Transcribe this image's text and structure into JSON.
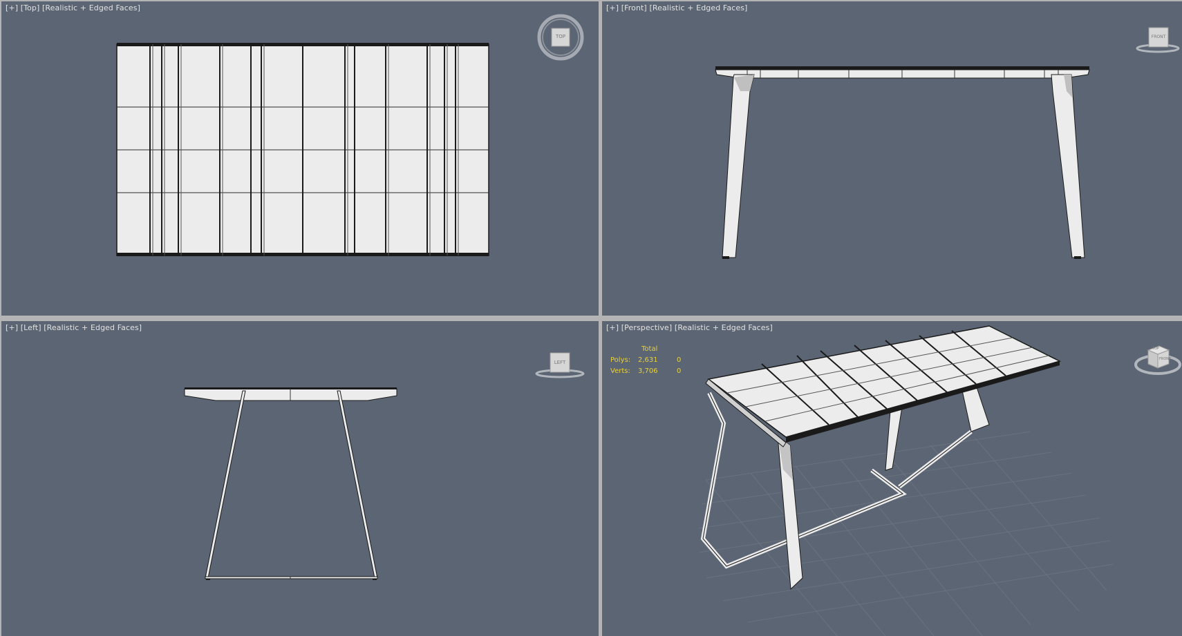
{
  "colors": {
    "viewport_bg": "#5c6573",
    "border": "#b4b4b4",
    "label_text": "#e2e2e2",
    "stats_text": "#e8d23a",
    "model_face": "#ececec",
    "model_edge": "#1a1a1a"
  },
  "viewports": {
    "top": {
      "plus": "[+]",
      "view": "[Top]",
      "mode": "[Realistic + Edged Faces]",
      "cube_label": "TOP",
      "cube_icon": "viewcube-icon"
    },
    "front": {
      "plus": "[+]",
      "view": "[Front]",
      "mode": "[Realistic + Edged Faces]",
      "cube_label": "FRONT",
      "cube_icon": "viewcube-icon"
    },
    "left": {
      "plus": "[+]",
      "view": "[Left]",
      "mode": "[Realistic + Edged Faces]",
      "cube_label": "LEFT",
      "cube_icon": "viewcube-icon"
    },
    "perspective": {
      "plus": "[+]",
      "view": "[Perspective]",
      "mode": "[Realistic + Edged Faces]",
      "cube_label": "TOP",
      "cube_label_2": "FRONT",
      "cube_icon": "viewcube-icon"
    }
  },
  "stats": {
    "header": "Total",
    "rows": [
      {
        "label": "Polys:",
        "total": "2,631",
        "selected": "0"
      },
      {
        "label": "Verts:",
        "total": "3,706",
        "selected": "0"
      }
    ]
  }
}
